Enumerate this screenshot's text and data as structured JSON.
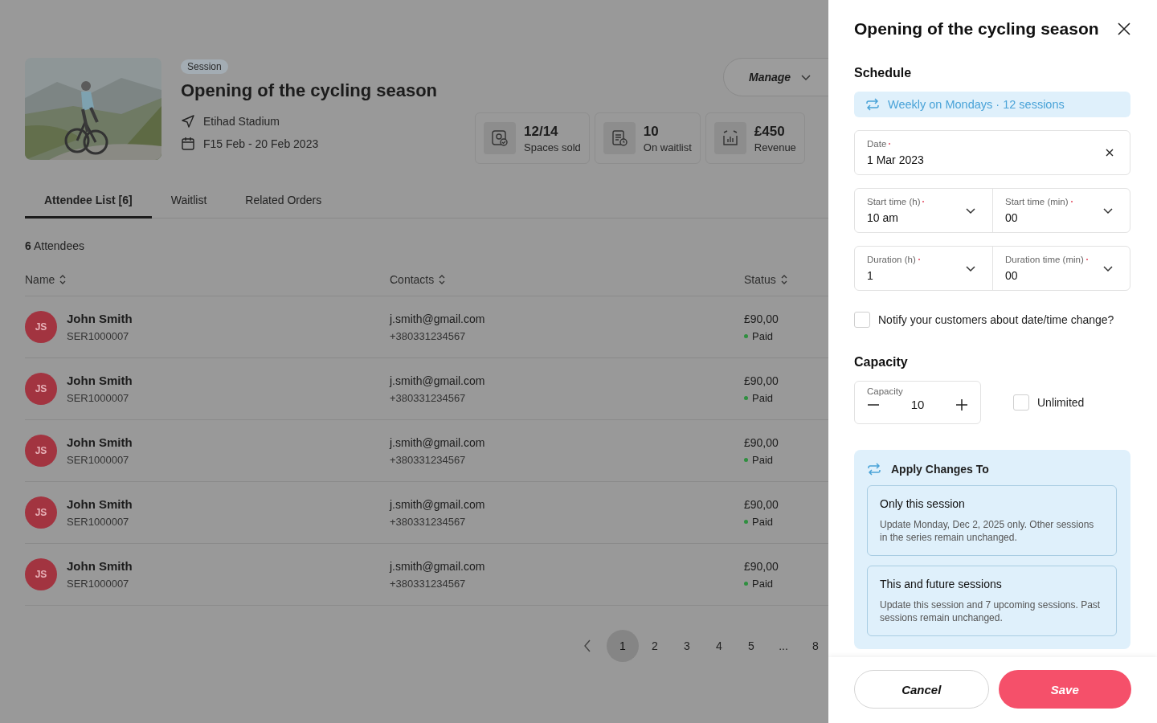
{
  "page": {
    "badge": "Session",
    "title": "Opening of the cycling season",
    "location": "Etihad Stadium",
    "dates": "F15 Feb - 20 Feb 2023",
    "manage_button": "Manage",
    "stats": [
      {
        "kind": "sold",
        "value": "12/14",
        "label": "Spaces sold"
      },
      {
        "kind": "waitlist",
        "value": "10",
        "label": "On waitlist"
      },
      {
        "kind": "revenue",
        "value": "£450",
        "label": "Revenue"
      }
    ],
    "tabs": [
      {
        "label": "Attendee List [6]",
        "selected": true
      },
      {
        "label": "Waitlist",
        "selected": false
      },
      {
        "label": "Related Orders",
        "selected": false
      }
    ],
    "attendee_count": "**6** Attendees",
    "columns": [
      "Name",
      "Contacts",
      "Status"
    ],
    "rows": [
      {
        "initials": "JS",
        "name": "John Smith",
        "id": "SER1000007",
        "email": "j.smith@gmail.com",
        "phone": "+380331234567",
        "amount": "£90,00",
        "status": "Paid",
        "color": "#2f8f3f"
      },
      {
        "initials": "JS",
        "name": "John Smith",
        "id": "SER1000007",
        "email": "j.smith@gmail.com",
        "phone": "+380331234567",
        "amount": "£90,00",
        "status": "Paid",
        "color": "#2f8f3f"
      },
      {
        "initials": "JS",
        "name": "John Smith",
        "id": "SER1000007",
        "email": "j.smith@gmail.com",
        "phone": "+380331234567",
        "amount": "£90,00",
        "status": "Paid",
        "color": "#2f8f3f"
      },
      {
        "initials": "JS",
        "name": "John Smith",
        "id": "SER1000007",
        "email": "j.smith@gmail.com",
        "phone": "+380331234567",
        "amount": "£90,00",
        "status": "Paid",
        "color": "#2f8f3f"
      },
      {
        "initials": "JS",
        "name": "John Smith",
        "id": "SER1000007",
        "email": "j.smith@gmail.com",
        "phone": "+380331234567",
        "amount": "£90,00",
        "status": "Paid",
        "color": "#2f8f3f"
      }
    ],
    "pagination": [
      {
        "label": "1",
        "selected": true
      },
      {
        "label": "2",
        "selected": false
      },
      {
        "label": "3",
        "selected": false
      },
      {
        "label": "4",
        "selected": false
      },
      {
        "label": "5",
        "selected": false
      },
      {
        "label": "...",
        "selected": false
      },
      {
        "label": "8",
        "selected": false
      }
    ]
  },
  "drawer": {
    "title": "Opening of the cycling season",
    "schedule_heading": "Schedule",
    "recurrence": "Weekly on Mondays · 12 sessions",
    "date": {
      "label": "Date",
      "required": true,
      "value": "1 Mar  2023"
    },
    "time_rows": [
      [
        {
          "label": "Start time (h)",
          "required": true,
          "value": "10 am"
        },
        {
          "label": "Start time (min)",
          "required": true,
          "value": "00"
        }
      ],
      [
        {
          "label": "Duration (h)",
          "required": true,
          "value": "1"
        },
        {
          "label": "Duration time (min)",
          "required": true,
          "value": "00"
        }
      ]
    ],
    "notify": {
      "label": "Notify your customers about date/time change?",
      "checked": false
    },
    "capacity_heading": "Capacity",
    "capacity": {
      "label": "Capacity",
      "value": "10"
    },
    "unlimited": {
      "label": "Unlimited",
      "checked": false
    },
    "apply": {
      "title": "Apply Changes To",
      "options": [
        {
          "title": "Only this session",
          "description": "Update Monday, Dec 2, 2025 only. Other sessions in the series remain unchanged.",
          "selected": false
        },
        {
          "title": "This and future sessions",
          "description": "Update this session and 7 upcoming sessions. Past sessions remain unchanged.",
          "selected": false
        }
      ]
    },
    "cancel_button": "Cancel",
    "save_button": "Save"
  }
}
